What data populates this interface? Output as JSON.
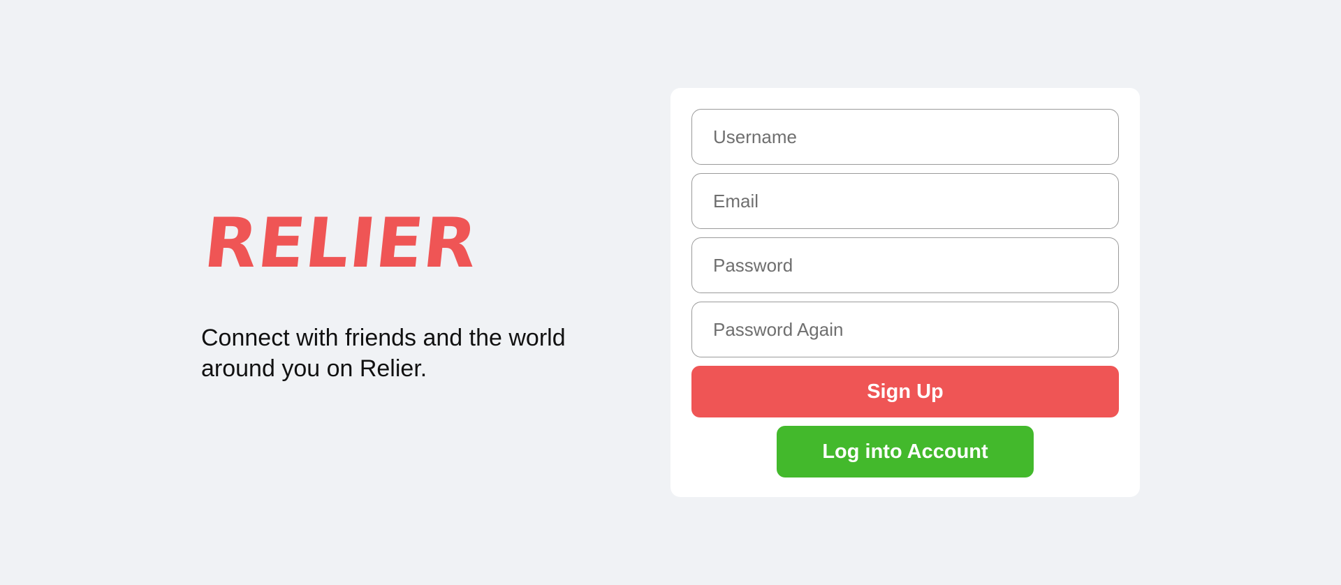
{
  "brand": {
    "name": "RELIER",
    "tagline": "Connect with friends and the world around you on Relier."
  },
  "form": {
    "username_placeholder": "Username",
    "email_placeholder": "Email",
    "password_placeholder": "Password",
    "password_again_placeholder": "Password Again",
    "signup_label": "Sign Up",
    "login_label": "Log into Account"
  },
  "colors": {
    "background": "#f0f2f5",
    "brand_red": "#ef5555",
    "login_green": "#43b92c",
    "card_white": "#ffffff"
  }
}
